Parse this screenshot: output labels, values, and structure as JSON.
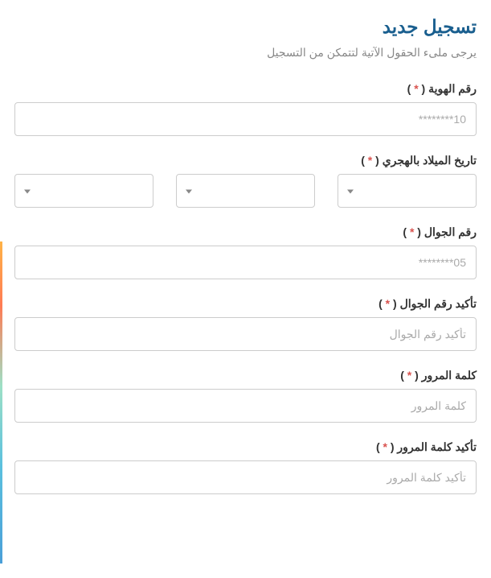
{
  "header": {
    "title": "تسجيل جديد",
    "subtitle": "يرجى ملىء الحقول الآتية لتتمكن من التسجيل"
  },
  "form": {
    "id_number": {
      "label": "رقم الهوية",
      "placeholder": "10********",
      "value": ""
    },
    "birth_date": {
      "label": "تاريخ الميلاد بالهجري",
      "day": "",
      "month": "",
      "year": ""
    },
    "mobile": {
      "label": "رقم الجوال",
      "placeholder": "05********",
      "value": ""
    },
    "mobile_confirm": {
      "label": "تأكيد رقم الجوال",
      "placeholder": "تأكيد رقم الجوال",
      "value": ""
    },
    "password": {
      "label": "كلمة المرور",
      "placeholder": "كلمة المرور",
      "value": ""
    },
    "password_confirm": {
      "label": "تأكيد كلمة المرور",
      "placeholder": "تأكيد كلمة المرور",
      "value": ""
    }
  },
  "required_marker": {
    "open": " ( ",
    "asterisk": "*",
    "close": " )"
  }
}
